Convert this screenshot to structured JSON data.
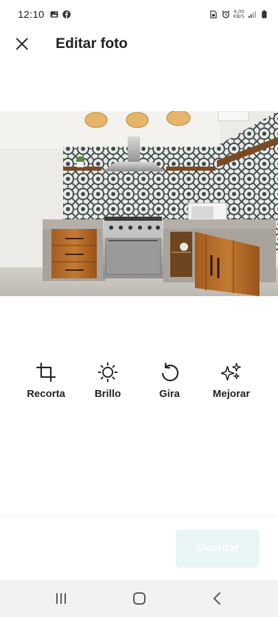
{
  "status_bar": {
    "time": "12:10",
    "left_icons": [
      "gallery-icon",
      "facebook-icon"
    ],
    "right_icons": [
      "sim-icon",
      "alarm-icon",
      "network-speed-icon",
      "signal-icon",
      "battery-icon"
    ],
    "network_speed_top": "4,00",
    "network_speed_bottom": "KB/S"
  },
  "header": {
    "close_icon": "close-icon",
    "title": "Editar foto"
  },
  "photo": {
    "description_icon": "photo"
  },
  "tools": [
    {
      "label": "Recorta",
      "icon": "crop-icon"
    },
    {
      "label": "Brillo",
      "icon": "brightness-icon"
    },
    {
      "label": "Gira",
      "icon": "rotate-icon"
    },
    {
      "label": "Mejorar",
      "icon": "sparkles-icon"
    }
  ],
  "footer": {
    "save_label": "Guardar",
    "save_state": "disabled",
    "save_color": "#e9f5f4"
  },
  "nav_bar": {
    "recents_icon": "recents-icon",
    "home_icon": "home-icon",
    "back_icon": "back-icon"
  }
}
